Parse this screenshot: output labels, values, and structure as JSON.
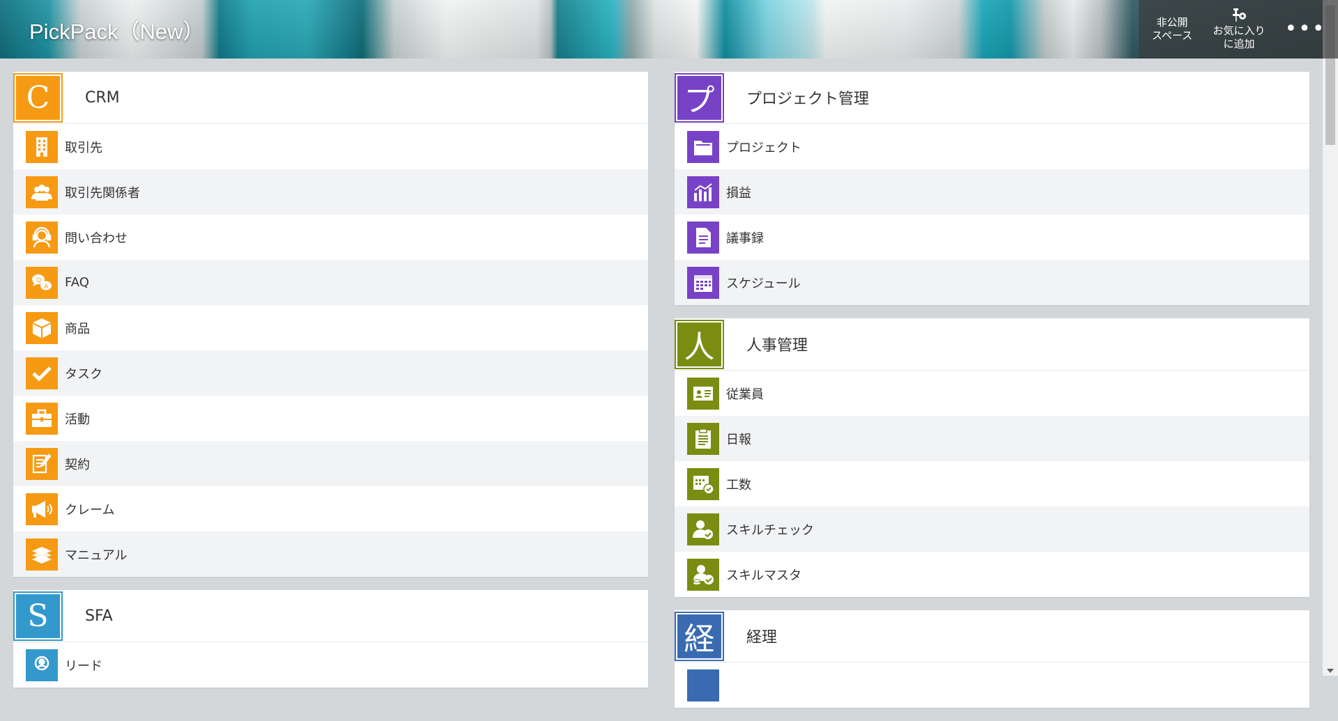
{
  "header": {
    "app_title": "PickPack（New）",
    "private_space": [
      "非公開",
      "スペース"
    ],
    "add_favorite": [
      "お気に入り",
      "に追加"
    ],
    "more_label": "•••"
  },
  "left_column": [
    {
      "glyph": "C",
      "title": "CRM",
      "color": "#f59a12",
      "items": [
        "取引先",
        "取引先関係者",
        "問い合わせ",
        "FAQ",
        "商品",
        "タスク",
        "活動",
        "契約",
        "クレーム",
        "マニュアル"
      ]
    },
    {
      "glyph": "S",
      "title": "SFA",
      "color": "#3399cc",
      "items": [
        "リード"
      ]
    }
  ],
  "right_column": [
    {
      "glyph": "プ",
      "title": "プロジェクト管理",
      "color": "#7742c6",
      "items": [
        "プロジェクト",
        "損益",
        "議事録",
        "スケジュール"
      ]
    },
    {
      "glyph": "人",
      "title": "人事管理",
      "color": "#7a8c12",
      "items": [
        "従業員",
        "日報",
        "工数",
        "スキルチェック",
        "スキルマスタ"
      ]
    },
    {
      "glyph": "経",
      "title": "経理",
      "color": "#3a6bb1",
      "items": []
    }
  ]
}
